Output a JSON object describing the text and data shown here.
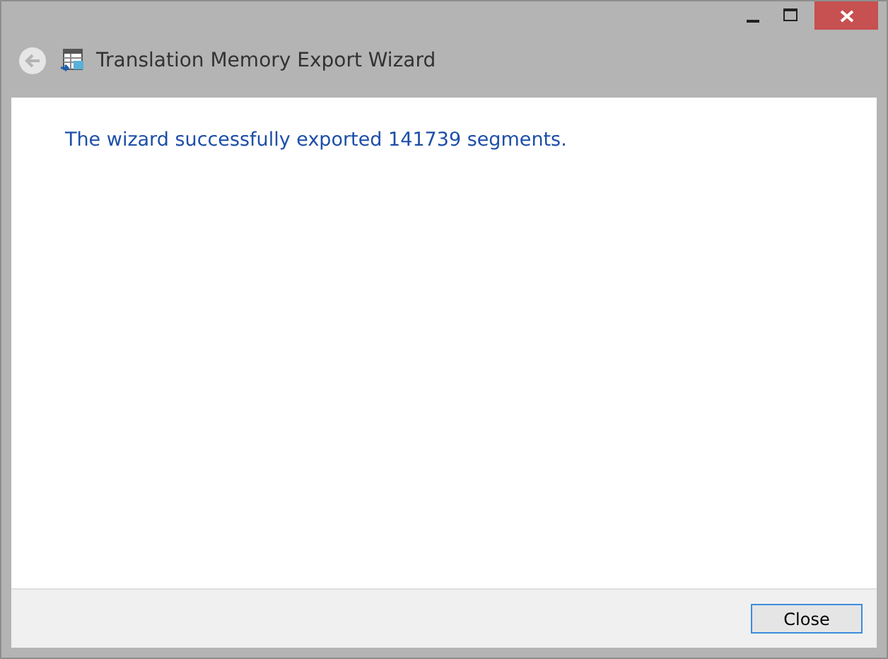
{
  "window": {
    "title": "Translation Memory Export Wizard"
  },
  "message": "The wizard successfully exported 141739 segments.",
  "buttons": [
    {
      "label": "Close"
    }
  ]
}
